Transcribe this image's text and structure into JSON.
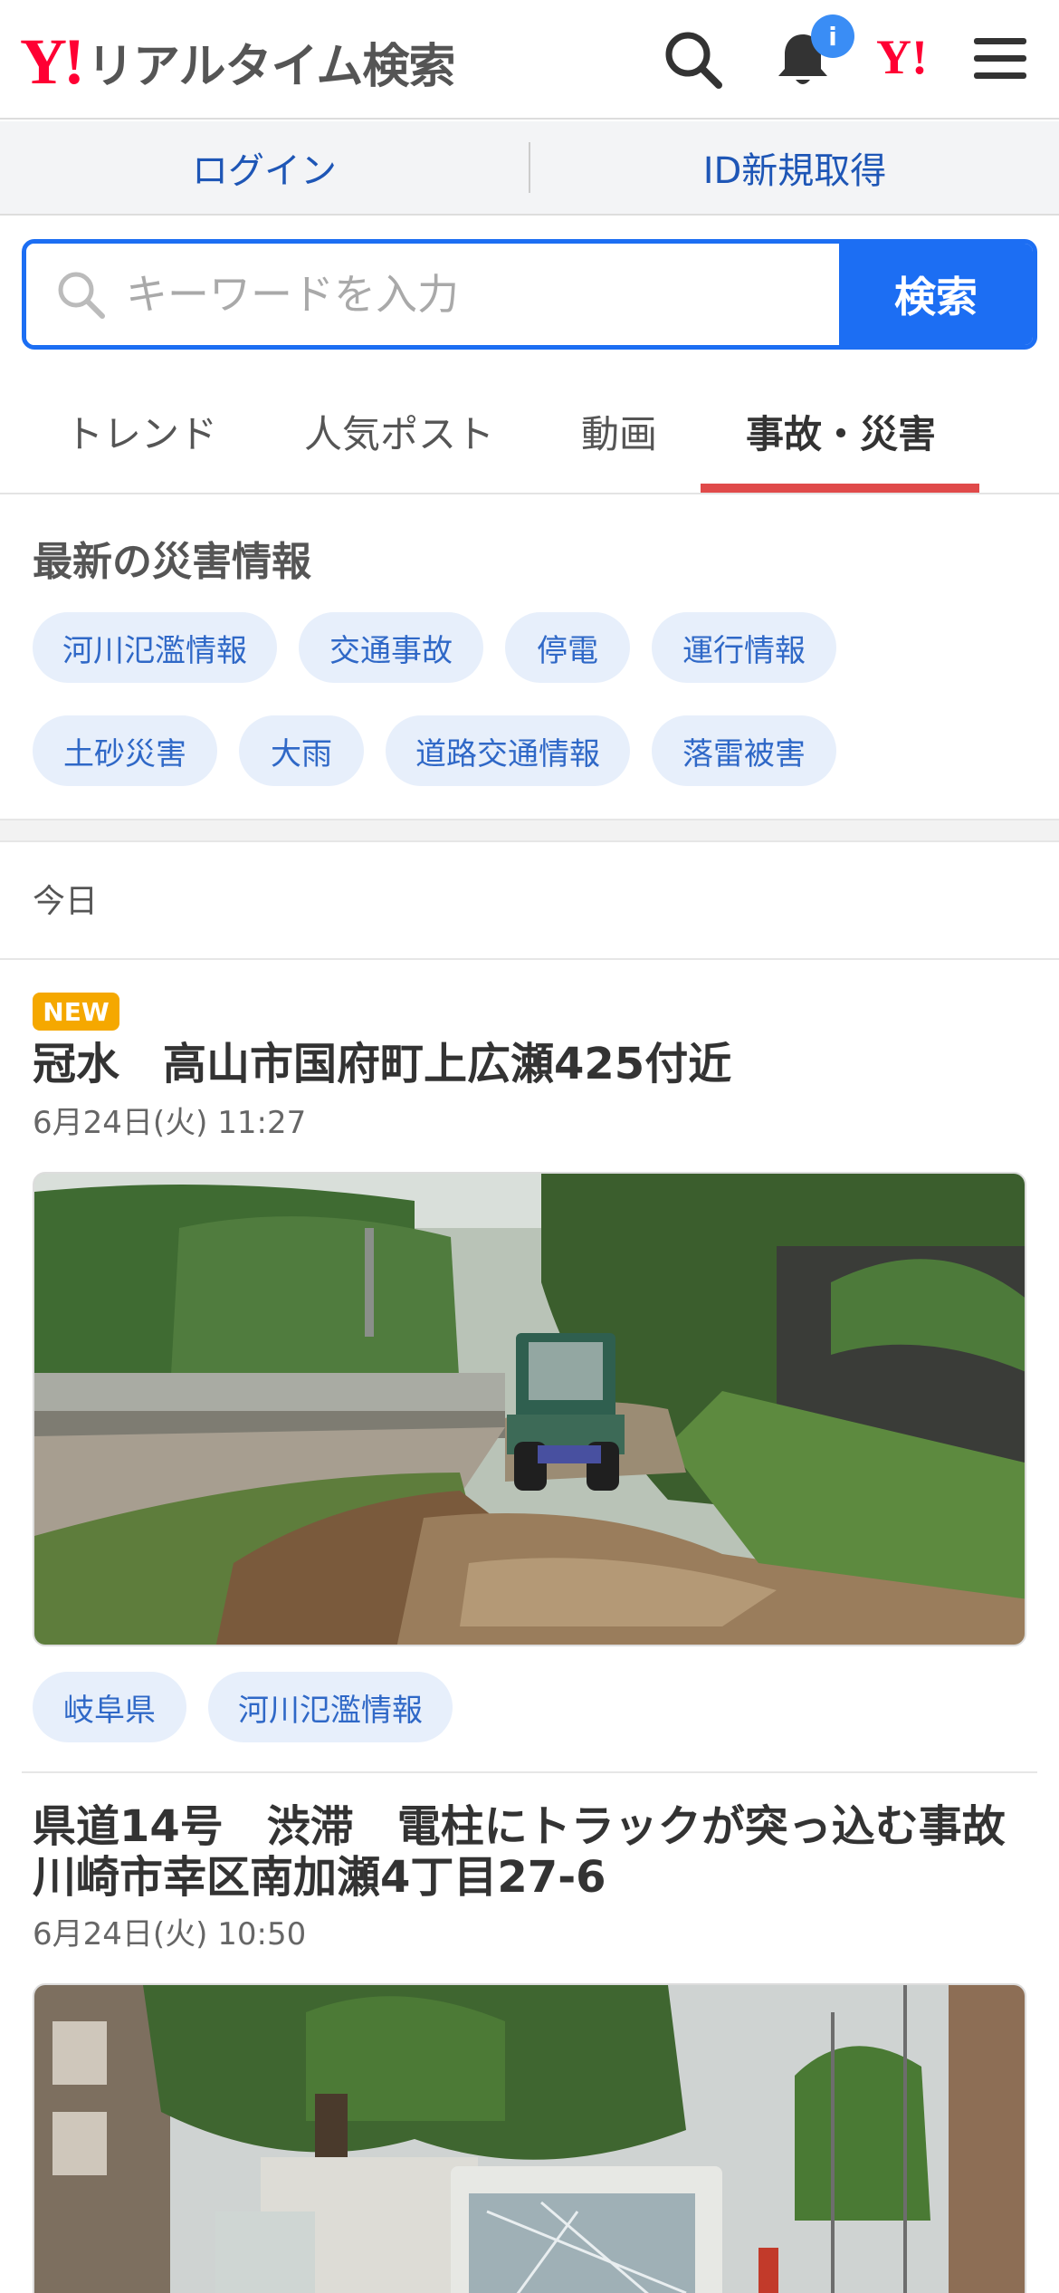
{
  "header": {
    "logo_mark": "Y!",
    "logo_text": "リアルタイム検索",
    "notification_badge": "i",
    "yahoo_mark": "Y!"
  },
  "loginbar": {
    "login": "ログイン",
    "register": "ID新規取得"
  },
  "search": {
    "placeholder": "キーワードを入力",
    "button": "検索"
  },
  "tabs": [
    "トレンド",
    "人気ポスト",
    "動画",
    "事故・災害"
  ],
  "disaster": {
    "title": "最新の災害情報",
    "chips": [
      "河川氾濫情報",
      "交通事故",
      "停電",
      "運行情報",
      "土砂災害",
      "大雨",
      "道路交通情報",
      "落雷被害"
    ]
  },
  "section_label": "今日",
  "articles": [
    {
      "badge": "NEW",
      "title": "冠水　高山市国府町上広瀬425付近",
      "date": "6月24日(火) 11:27",
      "tags": [
        "岐阜県",
        "河川氾濫情報"
      ]
    },
    {
      "title_line1": "県道14号　渋滞　電柱にトラックが突っ込む事故",
      "title_line2": "川崎市幸区南加瀬4丁目27-6",
      "date": "6月24日(火) 10:50"
    }
  ],
  "colors": {
    "brand_red": "#ff0033",
    "accent_blue": "#1c6ef3",
    "tab_underline": "#e04a4a",
    "chip_bg": "#e7effb",
    "new_badge": "#f5a800"
  }
}
